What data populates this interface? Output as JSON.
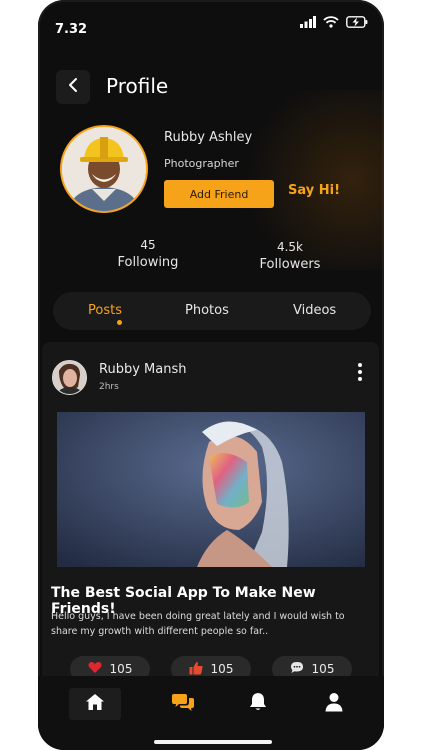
{
  "status_bar": {
    "time": "7.32"
  },
  "header": {
    "title": "Profile"
  },
  "profile": {
    "name": "Rubby Ashley",
    "role": "Photographer",
    "add_friend_label": "Add Friend",
    "say_hi_label": "Say Hi!"
  },
  "stats": [
    {
      "value": "45",
      "label": "Following"
    },
    {
      "value": "4.5k",
      "label": "Followers"
    }
  ],
  "tabs": [
    {
      "label": "Posts",
      "active": true
    },
    {
      "label": "Photos",
      "active": false
    },
    {
      "label": "Videos",
      "active": false
    }
  ],
  "post": {
    "author": "Rubby Mansh",
    "time": "2hrs",
    "title": "The Best Social App To Make New Friends!",
    "body": "Hello guys, I have been doing great lately and I would wish to share my growth with different people so far..",
    "reactions": [
      {
        "icon": "heart-icon",
        "count": "105"
      },
      {
        "icon": "thumbs-up-icon",
        "count": "105"
      },
      {
        "icon": "comment-icon",
        "count": "105"
      }
    ]
  },
  "bottom_nav": {
    "items": [
      {
        "icon": "home-icon",
        "active": true
      },
      {
        "icon": "chat-icon",
        "active": false
      },
      {
        "icon": "bell-icon",
        "active": false
      },
      {
        "icon": "user-icon",
        "active": false
      }
    ]
  },
  "colors": {
    "accent": "#f7a31a",
    "background": "#0e0e0e",
    "card": "#171717",
    "heart": "#e0262f",
    "thumb": "#e74a30"
  }
}
